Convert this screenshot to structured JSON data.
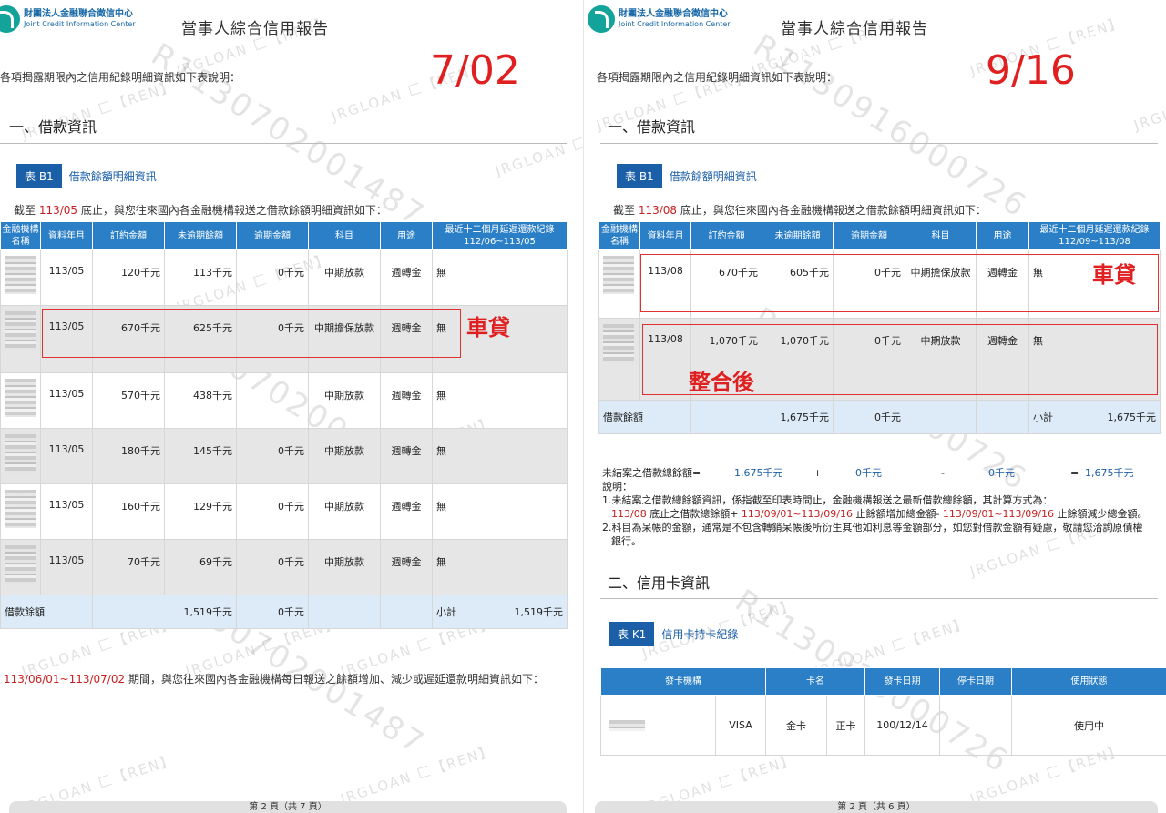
{
  "org": {
    "name_cn": "財團法人金融聯合徵信中心",
    "name_en": "Joint Credit Information Center"
  },
  "watermark": {
    "small": "JRGLOAN 匚【REN】",
    "left_id": "R1130702001487",
    "right_id": "R1130916000726"
  },
  "left": {
    "report_title": "當事人綜合信用報告",
    "intro": "各項揭露期限內之信用紀錄明細資訊如下表說明：",
    "big_date": "7/02",
    "section1": "一、借款資訊",
    "table_tag": "表 B1",
    "table_title": "借款餘額明細資訊",
    "cutoff_pre": "截至",
    "cutoff_date": "113/05",
    "cutoff_post": "底止，與您往來國內各金融機構報送之借款餘額明細資訊如下：",
    "headers": [
      "金融機構名稱",
      "資料年月",
      "訂約金額",
      "未逾期餘額",
      "逾期金額",
      "科目",
      "用途",
      "最近十二個月延遲還款紀錄"
    ],
    "header_period": "112/06~113/05",
    "rows": [
      [
        "113/05",
        "120千元",
        "113千元",
        "0千元",
        "中期放款",
        "週轉金",
        "無"
      ],
      [
        "113/05",
        "670千元",
        "625千元",
        "0千元",
        "中期擔保放款",
        "週轉金",
        "無"
      ],
      [
        "113/05",
        "570千元",
        "438千元",
        "",
        "中期放款",
        "週轉金",
        "無"
      ],
      [
        "113/05",
        "180千元",
        "145千元",
        "0千元",
        "中期放款",
        "週轉金",
        "無"
      ],
      [
        "113/05",
        "160千元",
        "129千元",
        "0千元",
        "中期放款",
        "週轉金",
        "無"
      ],
      [
        "113/05",
        "70千元",
        "69千元",
        "0千元",
        "中期放款",
        "週轉金",
        "無"
      ]
    ],
    "total_label": "借款餘額",
    "total_balance": "1,519千元",
    "total_overdue": "0千元",
    "subtotal_label": "小計",
    "subtotal_value": "1,519千元",
    "annotation": "車貸",
    "period_range": "113/06/01~113/07/02",
    "period_text": "期間，與您往來國內各金融機構每日報送之餘額增加、減少或遲延還款明細資訊如下：",
    "footer": "第 2 頁（共 7 頁）"
  },
  "right": {
    "report_title": "當事人綜合信用報告",
    "intro": "各項揭露期限內之信用紀錄明細資訊如下表說明：",
    "big_date": "9/16",
    "section1": "一、借款資訊",
    "table_tag": "表 B1",
    "table_title": "借款餘額明細資訊",
    "cutoff_pre": "截至",
    "cutoff_date": "113/08",
    "cutoff_post": "底止，與您往來國內各金融機構報送之借款餘額明細資訊如下：",
    "headers": [
      "金融機構名稱",
      "資料年月",
      "訂約金額",
      "未逾期餘額",
      "逾期金額",
      "科目",
      "用途",
      "最近十二個月延遲還款紀錄"
    ],
    "header_period": "112/09~113/08",
    "rows": [
      [
        "113/08",
        "670千元",
        "605千元",
        "0千元",
        "中期擔保放款",
        "週轉金",
        "無"
      ],
      [
        "113/08",
        "1,070千元",
        "1,070千元",
        "0千元",
        "中期放款",
        "週轉金",
        "無"
      ]
    ],
    "total_label": "借款餘額",
    "total_balance": "1,675千元",
    "total_overdue": "0千元",
    "subtotal_label": "小計",
    "subtotal_value": "1,675千元",
    "annotation_1": "車貸",
    "annotation_2": "整合後",
    "summary": {
      "label": "未結案之借款總餘額=",
      "v1": "1,675千元",
      "plus": "+",
      "v2": "0千元",
      "minus": "-",
      "v3": "0千元",
      "eq": "=",
      "result": "1,675千元"
    },
    "note_title": "說明：",
    "note1_a": "1.未結案之借款總餘額資訊，係指截至印表時間止，金融機構報送之最新借款總餘額，其計算方式為：",
    "note1_b1": "113/08",
    "note1_b2": " 底止之借款總餘額+ ",
    "note1_b3": "113/09/01~113/09/16",
    "note1_b4": " 止餘額增加總金額- ",
    "note1_b5": "113/09/01~113/09/16",
    "note1_b6": " 止餘額減少總金額。",
    "note2": "2.科目為呆帳的金額，通常是不包含轉銷呆帳後所衍生其他如利息等金額部分，如您對借款金額有疑慮，敬請您洽詢原債權銀行。",
    "section2": "二、信用卡資訊",
    "card_tag": "表 K1",
    "card_title": "信用卡持卡紀錄",
    "card_headers": [
      "發卡機構",
      "卡名",
      "",
      "發卡日期",
      "停卡日期",
      "使用狀態"
    ],
    "card_row": [
      "VISA",
      "金卡",
      "正卡",
      "100/12/14",
      "",
      "使用中"
    ],
    "footer": "第 2 頁（共 6 頁）"
  }
}
